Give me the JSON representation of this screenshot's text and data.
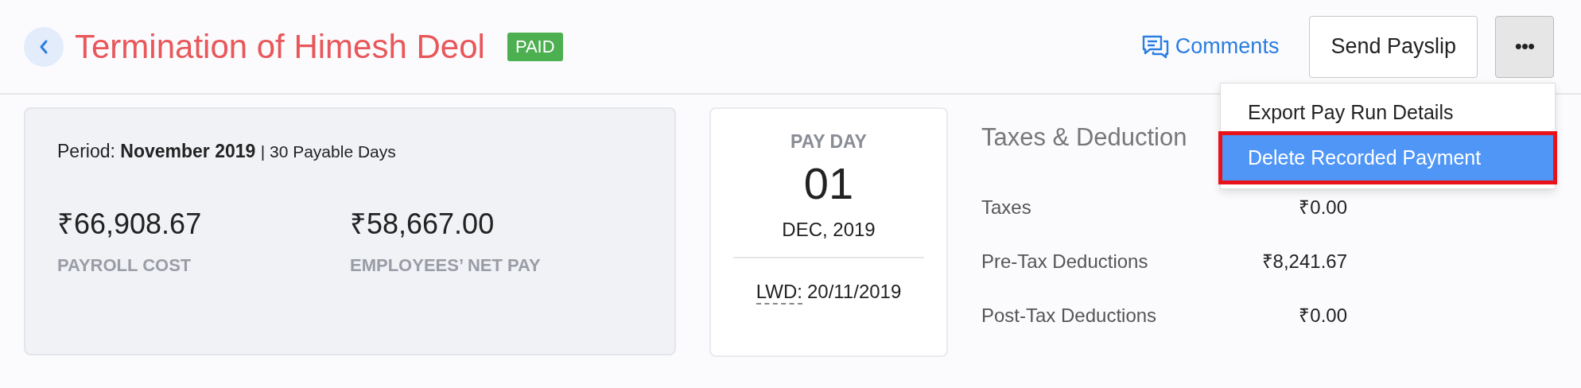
{
  "header": {
    "title": "Termination of Himesh Deol",
    "status_badge": "PAID",
    "comments_link": "Comments",
    "send_button": "Send Payslip",
    "more_button": "•••"
  },
  "menu": {
    "items": [
      {
        "label": "Export Pay Run Details",
        "selected": false,
        "highlighted": false
      },
      {
        "label": "Delete Recorded Payment",
        "selected": true,
        "highlighted": true
      }
    ]
  },
  "summary": {
    "period_label": "Period:",
    "period": "November 2019",
    "payable_days": "| 30 Payable Days",
    "amounts": [
      {
        "value": "₹66,908.67",
        "label": "PAYROLL COST"
      },
      {
        "value": "₹58,667.00",
        "label": "EMPLOYEES’ NET PAY"
      }
    ]
  },
  "pay_day": {
    "label": "PAY DAY",
    "day": "01",
    "month_year": "DEC, 2019",
    "lwd_label": "LWD:",
    "lwd_date": "20/11/2019"
  },
  "taxes": {
    "title": "Taxes & Deduction",
    "rows": [
      {
        "label": "Taxes",
        "value": "₹0.00"
      },
      {
        "label": "Pre-Tax Deductions",
        "value": "₹8,241.67"
      },
      {
        "label": "Post-Tax Deductions",
        "value": "₹0.00"
      }
    ]
  }
}
